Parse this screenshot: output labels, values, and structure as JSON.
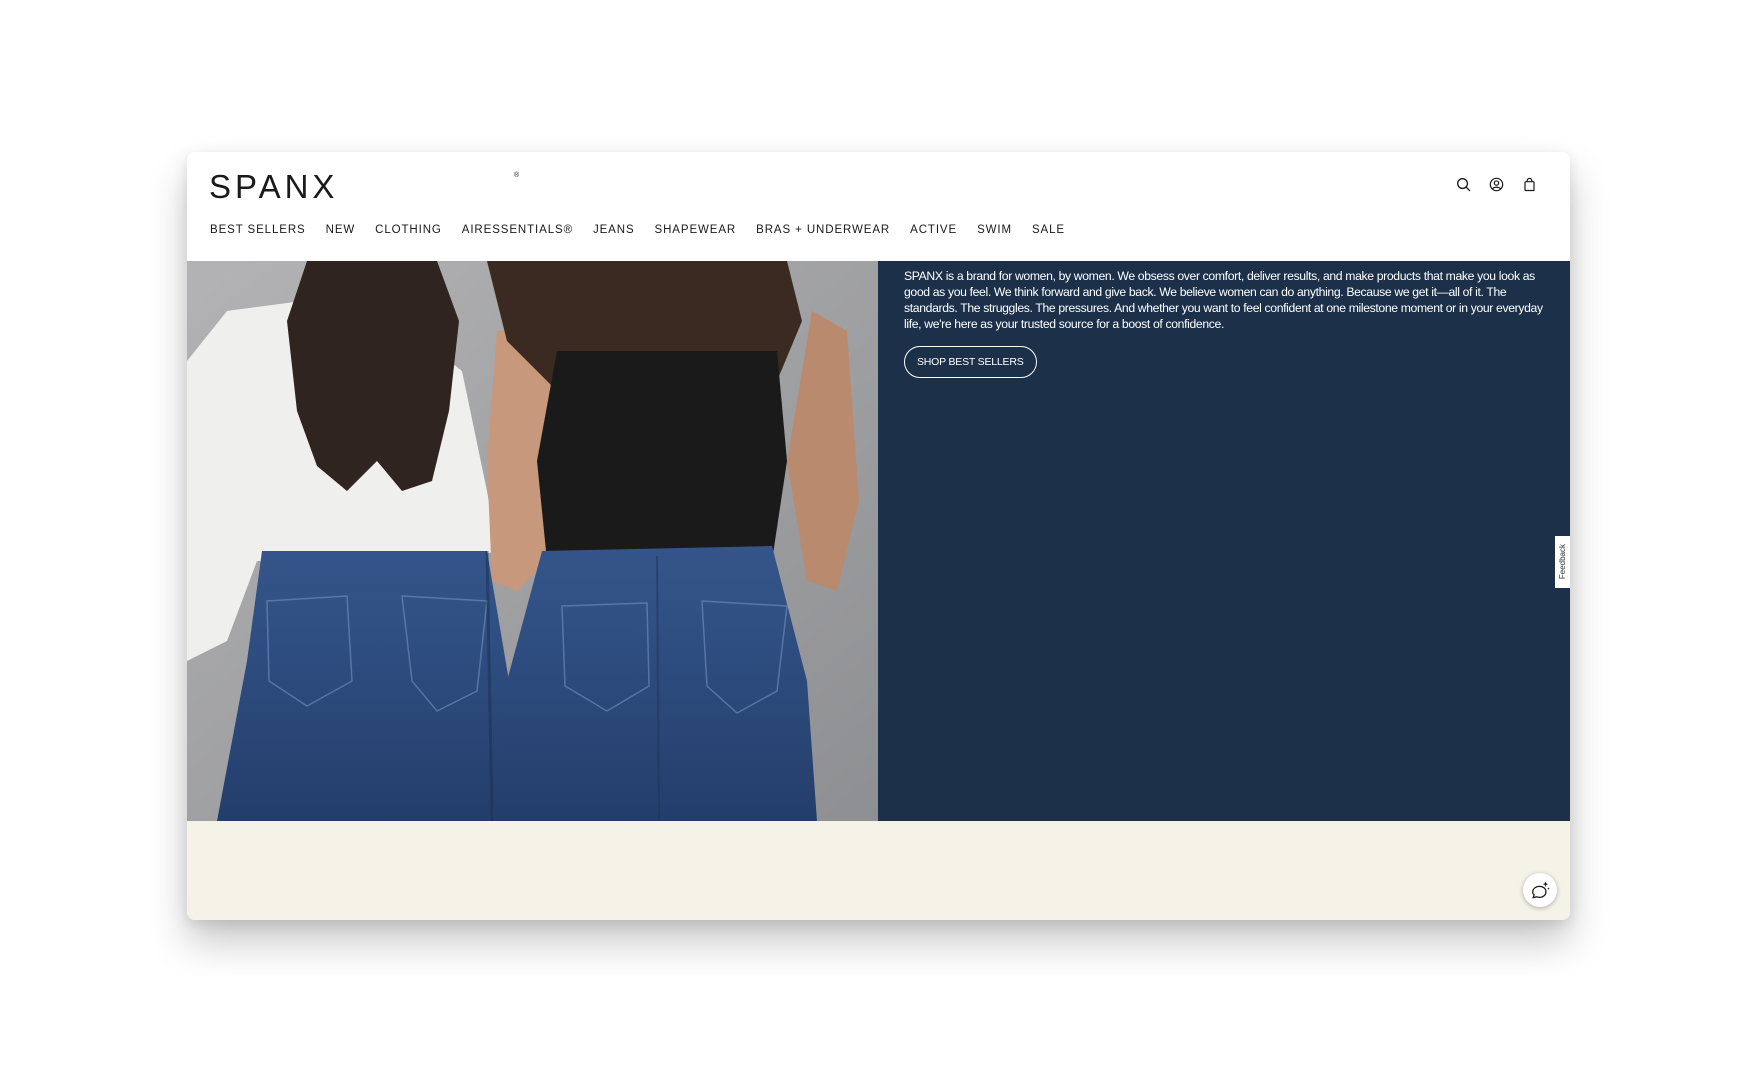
{
  "header": {
    "logo": "SPANX",
    "logo_mark": "®",
    "icons": [
      "search-icon",
      "account-icon",
      "bag-icon"
    ]
  },
  "nav": {
    "items": [
      {
        "label": "BEST SELLERS"
      },
      {
        "label": "NEW"
      },
      {
        "label": "CLOTHING"
      },
      {
        "label": "AIRESSENTIALS®"
      },
      {
        "label": "JEANS"
      },
      {
        "label": "SHAPEWEAR"
      },
      {
        "label": "BRAS + UNDERWEAR"
      },
      {
        "label": "ACTIVE"
      },
      {
        "label": "SWIM"
      },
      {
        "label": "SALE"
      }
    ]
  },
  "hero": {
    "body": "SPANX is a brand for women, by women. We obsess over comfort, deliver results, and make products that make you look as good as you feel. We think forward and give back. We believe women can do anything. Because we get it—all of it. The standards. The struggles. The pressures. And whether you want to feel confident at one milestone moment or in your everyday life, we're here as your trusted source for a boost of confidence.",
    "cta": "SHOP BEST SELLERS",
    "panel_color": "#1c3049"
  },
  "feedback": {
    "label": "Feedback"
  },
  "colors": {
    "cream": "#f5f3e8",
    "navy": "#1c3049"
  }
}
